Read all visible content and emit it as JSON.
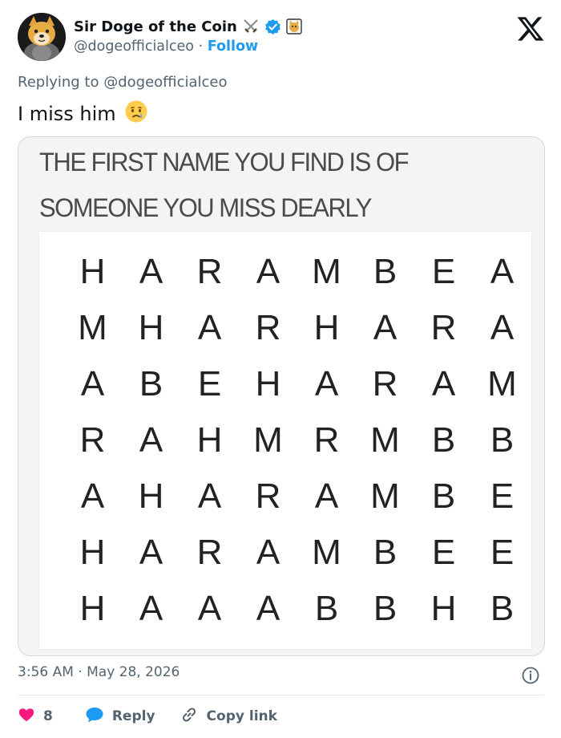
{
  "author": {
    "display_name": "Sir Doge of the Coin",
    "handle": "@dogeofficialceo",
    "separator": "·",
    "follow_label": "Follow",
    "verified_color": "#1d9bf0",
    "badges": [
      "crossed-swords-icon",
      "verified-badge-icon",
      "doge-badge-icon"
    ]
  },
  "brand": {
    "logo": "x-logo-icon"
  },
  "reply": {
    "prefix": "Replying to",
    "mention": "@dogeofficialceo"
  },
  "tweet": {
    "text": "I miss him",
    "emoji": "crying-face-icon"
  },
  "media": {
    "title_lines": [
      "THE FIRST NAME YOU FIND IS OF",
      "SOMEONE YOU MISS DEARLY"
    ],
    "grid": [
      [
        "H",
        "A",
        "R",
        "A",
        "M",
        "B",
        "E",
        "A"
      ],
      [
        "M",
        "H",
        "A",
        "R",
        "H",
        "A",
        "R",
        "A"
      ],
      [
        "A",
        "B",
        "E",
        "H",
        "A",
        "R",
        "A",
        "M"
      ],
      [
        "R",
        "A",
        "H",
        "M",
        "R",
        "M",
        "B",
        "B"
      ],
      [
        "A",
        "H",
        "A",
        "R",
        "A",
        "M",
        "B",
        "E"
      ],
      [
        "H",
        "A",
        "R",
        "A",
        "M",
        "B",
        "E",
        "E"
      ],
      [
        "H",
        "A",
        "A",
        "A",
        "B",
        "B",
        "H",
        "B"
      ]
    ]
  },
  "meta": {
    "time": "3:56 AM",
    "separator": "·",
    "date": "May 28, 2026"
  },
  "actions": {
    "like_count": "8",
    "reply_label": "Reply",
    "copy_link_label": "Copy link",
    "like_color": "#f91880",
    "reply_color": "#1d9bf0"
  }
}
